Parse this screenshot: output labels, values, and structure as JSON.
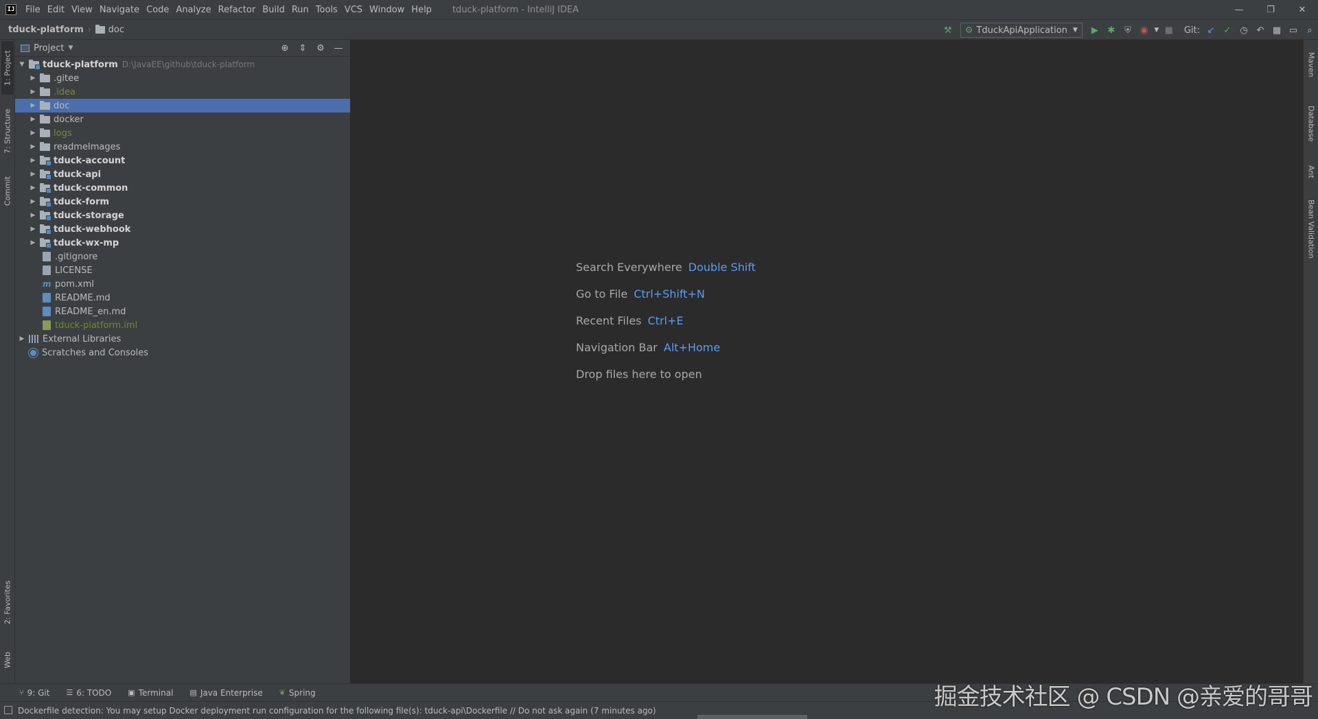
{
  "app": {
    "window_title": "tduck-platform - IntelliJ IDEA",
    "logo_text": "IJ"
  },
  "menu": [
    "File",
    "Edit",
    "View",
    "Navigate",
    "Code",
    "Analyze",
    "Refactor",
    "Build",
    "Run",
    "Tools",
    "VCS",
    "Window",
    "Help"
  ],
  "window_controls": {
    "minimize": "—",
    "restore": "❐",
    "close": "✕"
  },
  "breadcrumb": {
    "root": "tduck-platform",
    "folder": "doc"
  },
  "toolbar": {
    "run_config": "TduckApiApplication",
    "git_label": "Git:"
  },
  "left_tabs": [
    "1: Project",
    "7: Structure",
    "Commit",
    "2: Favorites",
    "Web"
  ],
  "right_tabs": [
    "Maven",
    "Database",
    "Ant",
    "Bean Validation"
  ],
  "project_panel": {
    "title": "Project",
    "root_name": "tduck-platform",
    "root_path": "D:\\JavaEE\\github\\tduck-platform",
    "items": [
      {
        "label": ".gitee"
      },
      {
        "label": ".idea"
      },
      {
        "label": "doc"
      },
      {
        "label": "docker"
      },
      {
        "label": "logs"
      },
      {
        "label": "readmeImages"
      },
      {
        "label": "tduck-account"
      },
      {
        "label": "tduck-api"
      },
      {
        "label": "tduck-common"
      },
      {
        "label": "tduck-form"
      },
      {
        "label": "tduck-storage"
      },
      {
        "label": "tduck-webhook"
      },
      {
        "label": "tduck-wx-mp"
      },
      {
        "label": ".gitignore"
      },
      {
        "label": "LICENSE"
      },
      {
        "label": "pom.xml"
      },
      {
        "label": "README.md"
      },
      {
        "label": "README_en.md"
      },
      {
        "label": "tduck-platform.iml"
      }
    ],
    "external_libraries": "External Libraries",
    "scratches": "Scratches and Consoles"
  },
  "editor_hints": [
    {
      "label": "Search Everywhere",
      "key": "Double Shift"
    },
    {
      "label": "Go to File",
      "key": "Ctrl+Shift+N"
    },
    {
      "label": "Recent Files",
      "key": "Ctrl+E"
    },
    {
      "label": "Navigation Bar",
      "key": "Alt+Home"
    },
    {
      "label": "Drop files here to open",
      "key": ""
    }
  ],
  "bottom_tabs": [
    {
      "label": "9: Git",
      "icon": "git-branch-icon"
    },
    {
      "label": "6: TODO",
      "icon": "todo-list-icon"
    },
    {
      "label": "Terminal",
      "icon": "terminal-icon"
    },
    {
      "label": "Java Enterprise",
      "icon": "java-enterprise-icon"
    },
    {
      "label": "Spring",
      "icon": "spring-leaf-icon"
    }
  ],
  "status": {
    "message": "Dockerfile detection: You may setup Docker deployment run configuration for the following file(s): tduck-api\\Dockerfile // Do not ask again (7 minutes ago)"
  },
  "watermark": "掘金技术社区 @ CSDN @亲爱的哥哥",
  "colors": {
    "selection": "#4b6eaf",
    "key_hint": "#589df6",
    "ignored_folder": "#7a8a3a"
  }
}
